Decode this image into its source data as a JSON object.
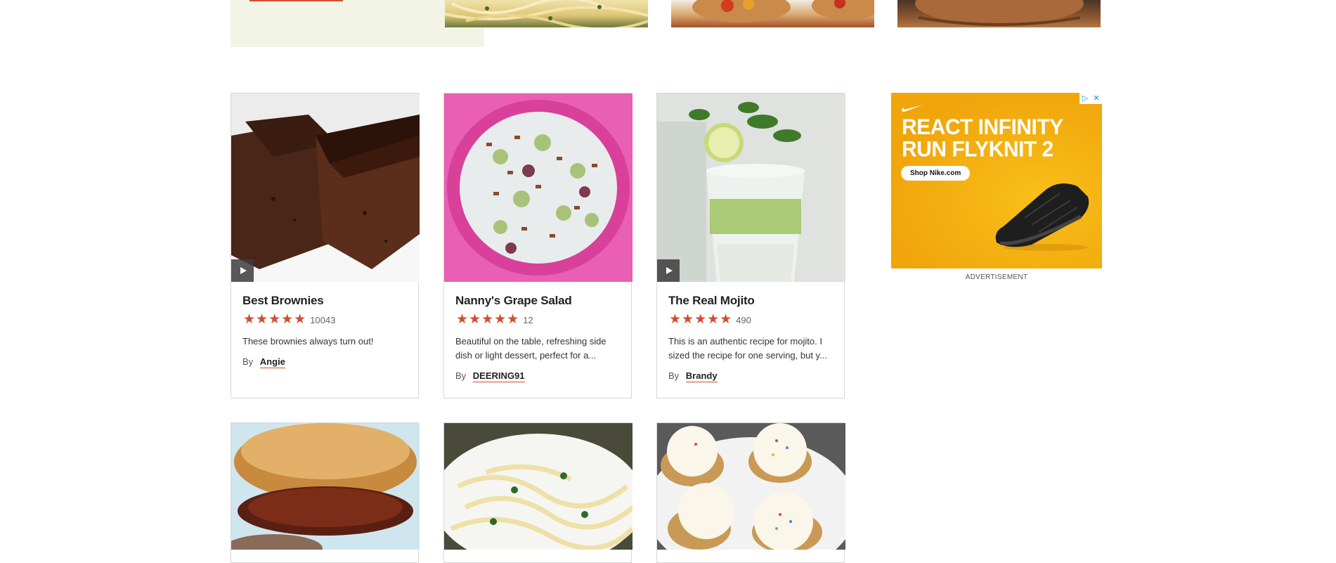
{
  "colors": {
    "accent": "#d24d2c",
    "promo_bg": "#f2f4e6",
    "ad_bg": "#f5b20f"
  },
  "recipes": [
    {
      "title": "Best Brownies",
      "rating": 5,
      "stars": "★★★★★",
      "review_count": "10043",
      "description": "These brownies always turn out!",
      "by_label": "By",
      "author": "Angie",
      "has_video": true
    },
    {
      "title": "Nanny's Grape Salad",
      "rating": 5,
      "stars": "★★★★★",
      "review_count": "12",
      "description": "Beautiful on the table, refreshing side dish or light dessert, perfect for a...",
      "by_label": "By",
      "author": "DEERING91",
      "has_video": false
    },
    {
      "title": "The Real Mojito",
      "rating": 5,
      "stars": "★★★★★",
      "review_count": "490",
      "description": "This is an authentic recipe for mojito. I sized the recipe for one serving, but y...",
      "by_label": "By",
      "author": "Brandy",
      "has_video": true
    }
  ],
  "ad": {
    "headline_line1": "REACT INFINITY",
    "headline_line2": "RUN FLYKNIT 2",
    "cta": "Shop Nike.com",
    "label": "ADVERTISEMENT",
    "choices_icon": "ad-choices-icon",
    "close_icon": "close-icon",
    "logo_icon": "nike-swoosh-icon"
  },
  "icons": {
    "play": "play-icon",
    "star": "star-icon"
  }
}
